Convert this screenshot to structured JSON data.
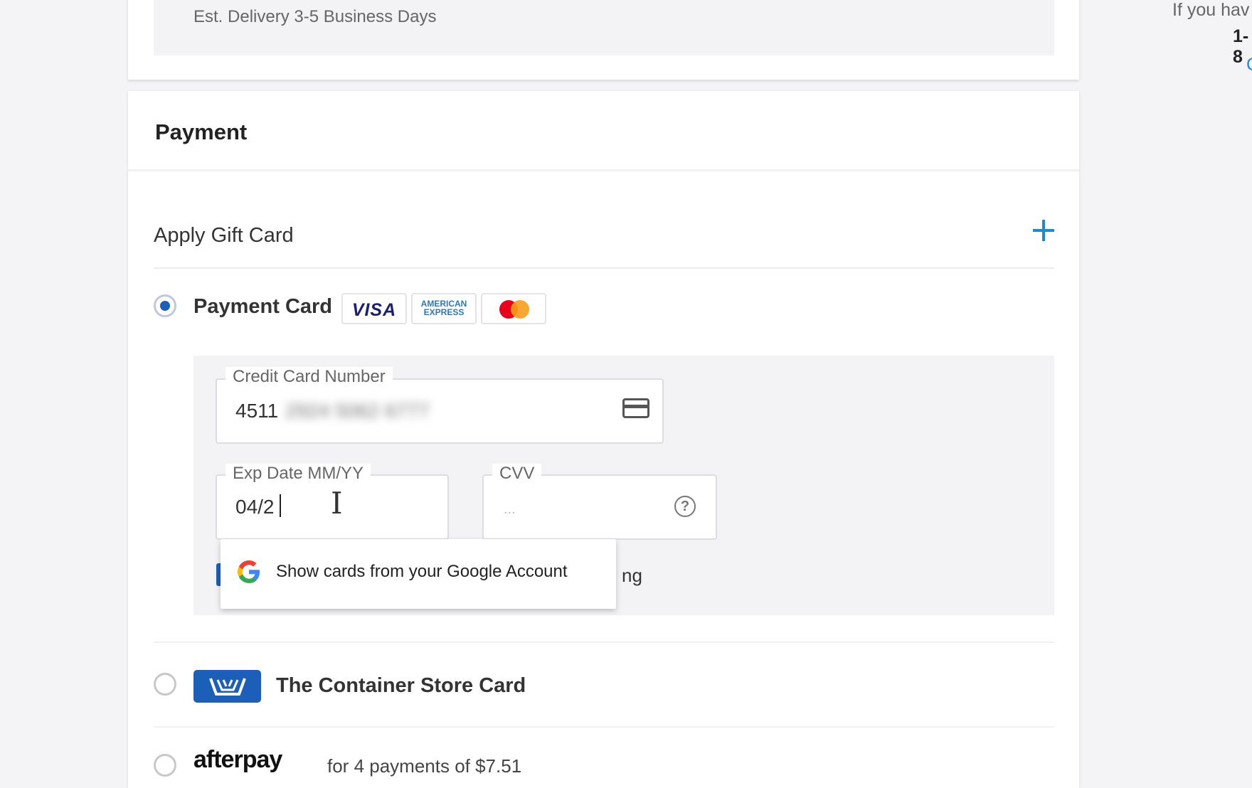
{
  "shipping": {
    "delivery_estimate": "Est. Delivery 3-5 Business Days"
  },
  "payment": {
    "title": "Payment",
    "gift_card_label": "Apply Gift Card",
    "payment_card_label": "Payment Card",
    "brand_logos": {
      "visa": "VISA",
      "amex_line1": "AMERICAN",
      "amex_line2": "EXPRESS"
    },
    "credit_card": {
      "label": "Credit Card Number",
      "value_visible": "4511",
      "value_blurred": "2924 5062 6777"
    },
    "exp_date": {
      "label": "Exp Date MM/YY",
      "value": "04/2"
    },
    "cvv": {
      "label": "CVV",
      "placeholder": "..."
    },
    "hidden_checkbox_text_tail": "ng",
    "autofill_suggestion": "Show cards from your Google Account",
    "container_store_card_label": "The Container Store Card",
    "afterpay_logo_text": "afterpay",
    "afterpay_text": "for 4 payments of $7.51"
  },
  "right_panel": {
    "help_text": "If you hav",
    "phone_partial": "1-8",
    "link_partial": "C"
  },
  "colors": {
    "accent_blue": "#1e8bd0",
    "radio_blue": "#1b5fb8",
    "visa_navy": "#1a1f71",
    "mastercard_red": "#eb001b",
    "mastercard_orange": "#f79e1b"
  },
  "icons": [
    "plus-icon",
    "credit-card-icon",
    "help-circle-icon",
    "google-g-icon",
    "container-store-logo",
    "text-cursor-icon"
  ]
}
